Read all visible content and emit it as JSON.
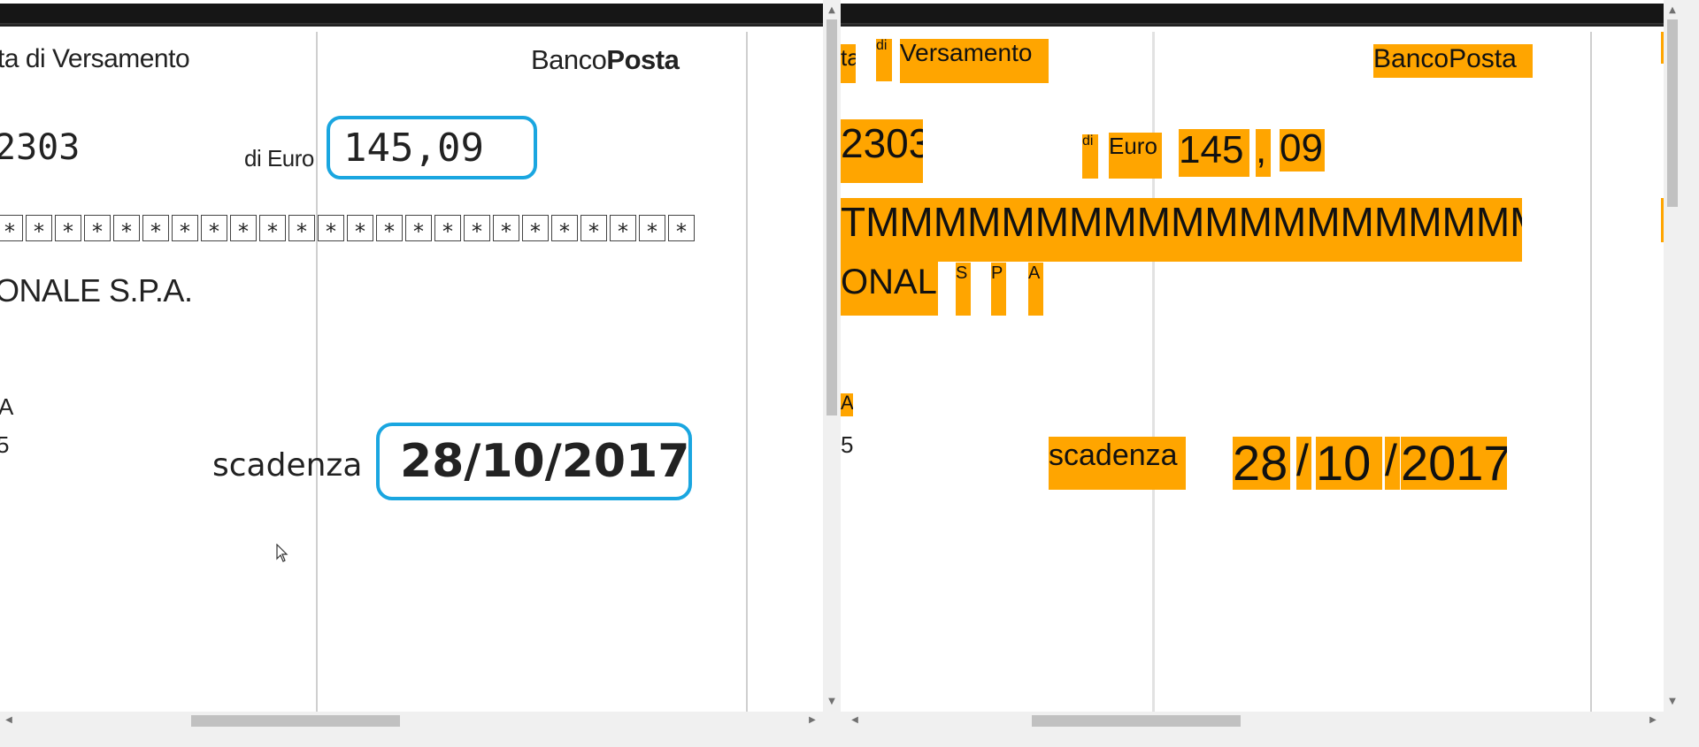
{
  "left_doc": {
    "header_left": "ta di Versamento",
    "brand_banco": "Banco",
    "brand_posta": "Posta",
    "account": "2303",
    "di_euro_label": "di Euro",
    "amount": "145,09",
    "star_char": "*",
    "star_count": 24,
    "payee": "ONALE S.P.A.",
    "frag_a": "A",
    "frag_5": "5",
    "scadenza_label": "scadenza",
    "due_date": "28/10/2017"
  },
  "right_doc": {
    "header_frag": "ta",
    "header_di": "di",
    "header_versamento": "Versamento",
    "brand": "BancoPosta",
    "account": "2303",
    "di": "di",
    "euro": "Euro",
    "amount_int": "145",
    "amount_comma": ",",
    "amount_dec": "09",
    "m_row": "TMMMMMMMMMMMMMMMMMMMMMM",
    "payee": "ONALE",
    "s": "S",
    "p": "P",
    "a": "A",
    "frag_a": "A",
    "frag_5": "5",
    "scadenza_label": "scadenza",
    "day": "28",
    "slash1": "/",
    "month": "10",
    "slash2": "/",
    "year": "2017"
  },
  "colors": {
    "highlight": "#1aa6e0",
    "ocr_overlay": "#ffa500",
    "scrollbar_thumb": "#c1c1c1"
  },
  "icons": {
    "scroll_up": "▲",
    "scroll_down": "▼",
    "scroll_left": "◀",
    "scroll_right": "▶"
  }
}
